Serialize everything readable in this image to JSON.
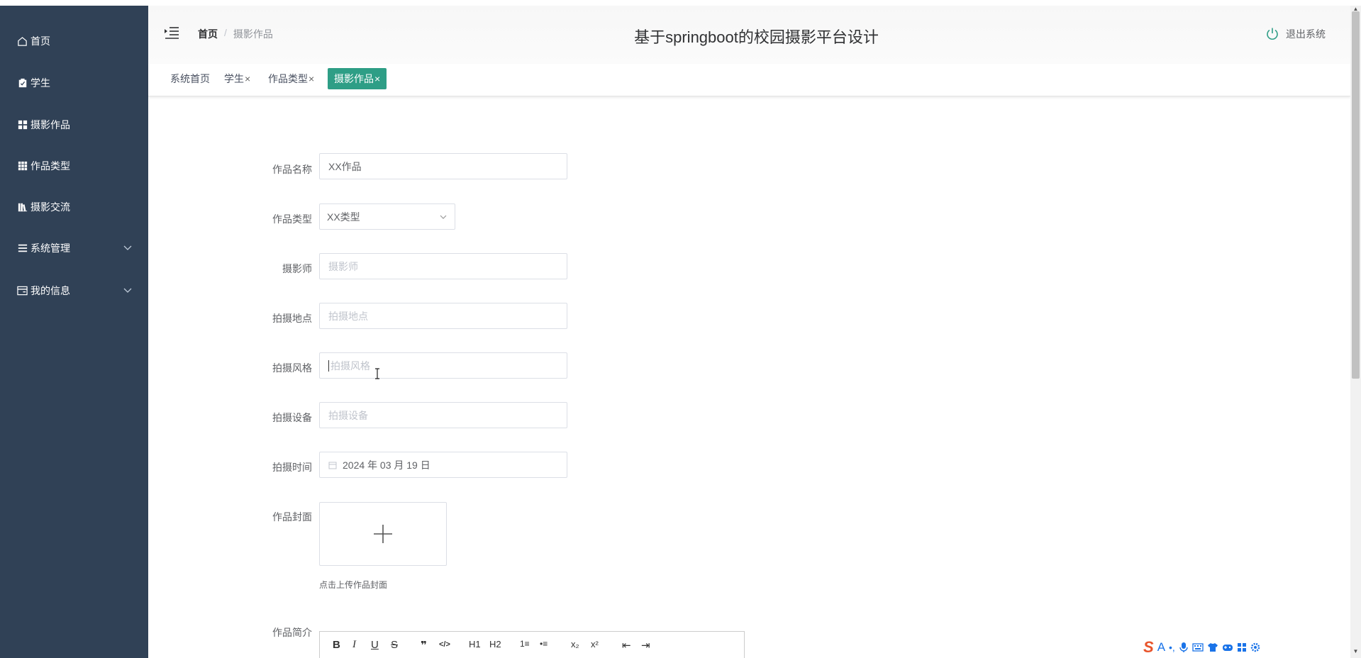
{
  "sidebar": {
    "items": [
      {
        "label": "首页",
        "icon": "home-icon"
      },
      {
        "label": "学生",
        "icon": "clipboard-icon"
      },
      {
        "label": "摄影作品",
        "icon": "grid-icon"
      },
      {
        "label": "作品类型",
        "icon": "table-icon"
      },
      {
        "label": "摄影交流",
        "icon": "library-icon"
      },
      {
        "label": "系统管理",
        "icon": "list-settings-icon"
      },
      {
        "label": "我的信息",
        "icon": "id-card-icon"
      }
    ]
  },
  "header": {
    "breadcrumb": [
      "首页",
      "摄影作品"
    ],
    "breadcrumb_sep": "/",
    "title": "基于springboot的校园摄影平台设计",
    "logout": "退出系统"
  },
  "tabs": [
    {
      "label": "系统首页",
      "closable": false,
      "active": false
    },
    {
      "label": "学生",
      "closable": true,
      "active": false
    },
    {
      "label": "作品类型",
      "closable": true,
      "active": false
    },
    {
      "label": "摄影作品",
      "closable": true,
      "active": true
    }
  ],
  "close_glyph": "×",
  "form": {
    "name": {
      "label": "作品名称",
      "value": "XX作品"
    },
    "type": {
      "label": "作品类型",
      "value": "XX类型"
    },
    "photographer": {
      "label": "摄影师",
      "placeholder": "摄影师"
    },
    "location": {
      "label": "拍摄地点",
      "placeholder": "拍摄地点"
    },
    "style": {
      "label": "拍摄风格",
      "placeholder": "拍摄风格"
    },
    "device": {
      "label": "拍摄设备",
      "placeholder": "拍摄设备"
    },
    "time": {
      "label": "拍摄时间",
      "value": "2024 年 03 月 19 日"
    },
    "cover": {
      "label": "作品封面",
      "tip": "点击上传作品封面"
    },
    "intro": {
      "label": "作品简介"
    }
  },
  "editor_tools": [
    "B",
    "I",
    "U",
    "S",
    "❞",
    "</>",
    "H1",
    "H2",
    "1≡",
    "•≡",
    "x₂",
    "x²",
    "⇤",
    "⇥"
  ],
  "ime": {
    "logo": "S",
    "mode": "A",
    "punct": "•,"
  },
  "colors": {
    "sidebar_bg": "#304156",
    "accent": "#2e9e86"
  }
}
